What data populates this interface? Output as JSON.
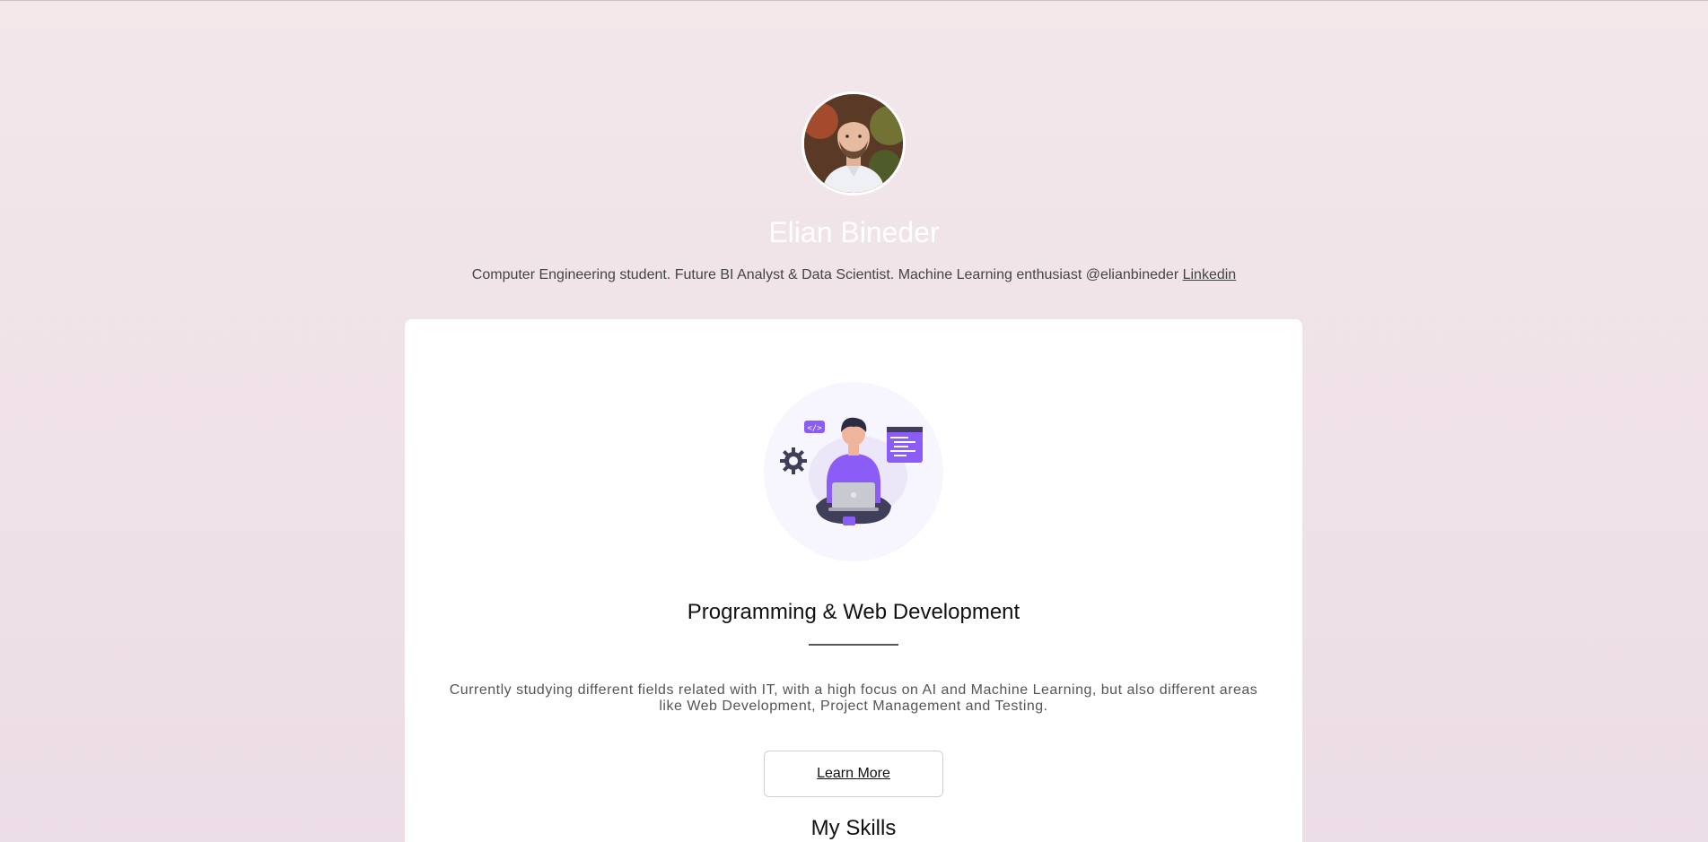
{
  "profile": {
    "name": "Elian Bineder",
    "bio": "Computer Engineering student. Future BI Analyst & Data Scientist. Machine Learning enthusiast @elianbineder",
    "link_label": "Linkedin"
  },
  "card": {
    "title": "Programming & Web Development",
    "description": "Currently studying different fields related with IT, with a high focus on AI and Machine Learning, but also different areas like Web Development, Project Management and Testing.",
    "button_label": "Learn More",
    "next_section_title": "My Skills"
  },
  "icons": {
    "avatar": "profile-photo",
    "illustration": "developer-with-laptop-illustration",
    "code_tag": "code-tag-icon",
    "gear": "gear-icon",
    "window": "code-window-icon"
  },
  "colors": {
    "background_top": "#f3e7ea",
    "background_bottom": "#ecdde6",
    "accent_purple": "#8b5cf6",
    "card": "#ffffff"
  }
}
